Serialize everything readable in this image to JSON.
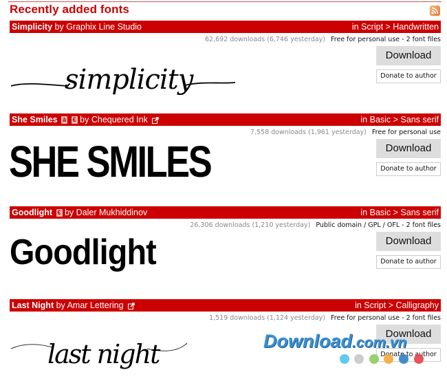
{
  "page": {
    "title": "Recently added fonts",
    "rss_icon": "rss-feed-icon"
  },
  "fonts": [
    {
      "name": "Simplicity",
      "by": "by",
      "author": "Graphix Line Studio",
      "badges": [],
      "external_link": false,
      "category": "in Script > Handwritten",
      "downloads": "62,692 downloads (6,746 yesterday)",
      "license": "Free for personal use - 2 font files",
      "preview_text": "simplicity",
      "download_label": "Download",
      "donate_label": "Donate to author"
    },
    {
      "name": "She Smiles",
      "by": "by",
      "author": "Chequered Ink",
      "badges": [
        "à",
        "€"
      ],
      "external_link": true,
      "category": "in Basic > Sans serif",
      "downloads": "7,558 downloads (1,961 yesterday)",
      "license": "Free for personal use",
      "preview_text": "SHE SMILES",
      "download_label": "Download",
      "donate_label": "Donate to author"
    },
    {
      "name": "Goodlight",
      "by": "by",
      "author": "Daler Mukhiddinov",
      "badges": [
        "€"
      ],
      "external_link": false,
      "category": "in Basic > Sans serif",
      "downloads": "26,306 downloads (1,210 yesterday)",
      "license": "Public domain / GPL / OFL - 2 font files",
      "preview_text": "Goodlight",
      "download_label": "Download",
      "donate_label": "Donate to author"
    },
    {
      "name": "Last Night",
      "by": "by",
      "author": "Amar Lettering",
      "badges": [],
      "external_link": true,
      "category": "in Script > Calligraphy",
      "downloads": "1,519 downloads (1,124 yesterday)",
      "license": "Free for personal use - 2 font files",
      "preview_text": "last night",
      "download_label": "Download",
      "donate_label": "Donate to author"
    }
  ],
  "watermark": {
    "brand": "Download",
    "domain": ".com.vn",
    "dot_colors": [
      "#4cc3f0",
      "#c8c8c8",
      "#8ccc5a",
      "#f5a93a",
      "#2f7fc8",
      "#e8404a"
    ]
  },
  "colors": {
    "accent": "#cc0000",
    "button_bg": "#dddddd"
  }
}
